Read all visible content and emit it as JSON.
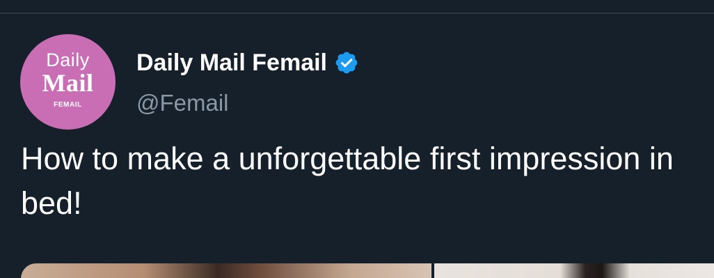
{
  "account": {
    "display_name": "Daily Mail Femail",
    "handle": "@Femail",
    "verified": true,
    "avatar": {
      "line1": "Daily",
      "line2": "Mail",
      "line3": "FEMAIL",
      "background": "#c96eb5"
    }
  },
  "tweet": {
    "text": "How to make a unforgettable first impression in bed!"
  },
  "colors": {
    "background": "#15202b",
    "text": "#ffffff",
    "secondary_text": "#8b98a5",
    "verified_badge": "#1d9bf0"
  },
  "icons": {
    "verified": "verified-badge-icon"
  }
}
